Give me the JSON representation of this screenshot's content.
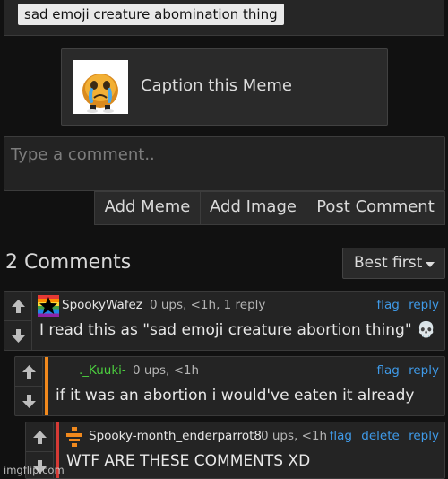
{
  "post": {
    "title_tag": "sad emoji creature abomination thing"
  },
  "caption": {
    "label": "Caption this Meme",
    "thumbnail_icon": "crying-emoji-creature-icon"
  },
  "comment_form": {
    "placeholder": "Type a comment..",
    "buttons": {
      "add_meme": "Add Meme",
      "add_image": "Add Image",
      "post_comment": "Post Comment"
    }
  },
  "comments_header": {
    "count_label": "2 Comments",
    "sort_value": "Best first"
  },
  "comments": [
    {
      "username": "SpookyWafez",
      "username_color": "#d0d0d0",
      "meta": "0 ups, <1h, 1 reply",
      "text": "I read this as \"sad emoji creature abortion thing\" 💀",
      "flag": "flag",
      "delete": "",
      "reply": "reply"
    },
    {
      "username": "._Kuuki-",
      "username_color": "#4ccf3f",
      "meta": "0 ups, <1h",
      "text": "if it was an abortion i would've eaten it already",
      "flag": "flag",
      "delete": "",
      "reply": "reply"
    },
    {
      "username": "Spooky-month_enderparrot8",
      "username_color": "#bdbdbd",
      "meta": "0 ups, <1h",
      "text": "WTF ARE THESE COMMENTS XD",
      "flag": "flag",
      "delete": "delete",
      "reply": "reply"
    }
  ],
  "watermark": "imgflip.com",
  "colors": {
    "background": "#111111",
    "panel": "#242424",
    "link": "#3f9ae8",
    "reply_stripe_orange": "#f1891d",
    "reply_stripe_red": "#d63a35"
  }
}
